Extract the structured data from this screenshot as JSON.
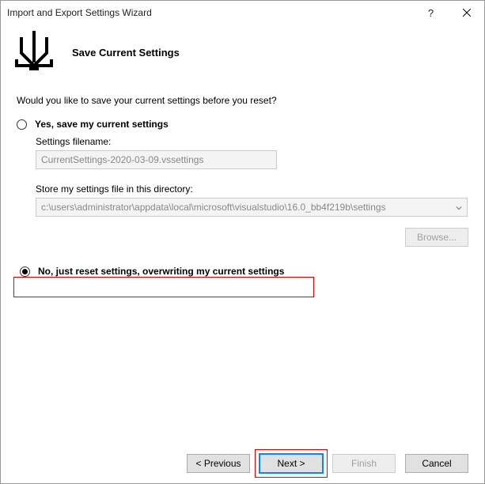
{
  "titlebar": {
    "title": "Import and Export Settings Wizard",
    "help": "?",
    "close": "✕"
  },
  "header": {
    "title": "Save Current Settings"
  },
  "content": {
    "prompt": "Would you like to save your current settings before you reset?",
    "option_yes": {
      "label": "Yes, save my current settings",
      "filename_label": "Settings filename:",
      "filename_value": "CurrentSettings-2020-03-09.vssettings",
      "directory_label": "Store my settings file in this directory:",
      "directory_value": "c:\\users\\administrator\\appdata\\local\\microsoft\\visualstudio\\16.0_bb4f219b\\settings",
      "browse_label": "Browse..."
    },
    "option_no": {
      "label": "No, just reset settings, overwriting my current settings"
    }
  },
  "footer": {
    "previous": "< Previous",
    "next": "Next >",
    "finish": "Finish",
    "cancel": "Cancel"
  }
}
